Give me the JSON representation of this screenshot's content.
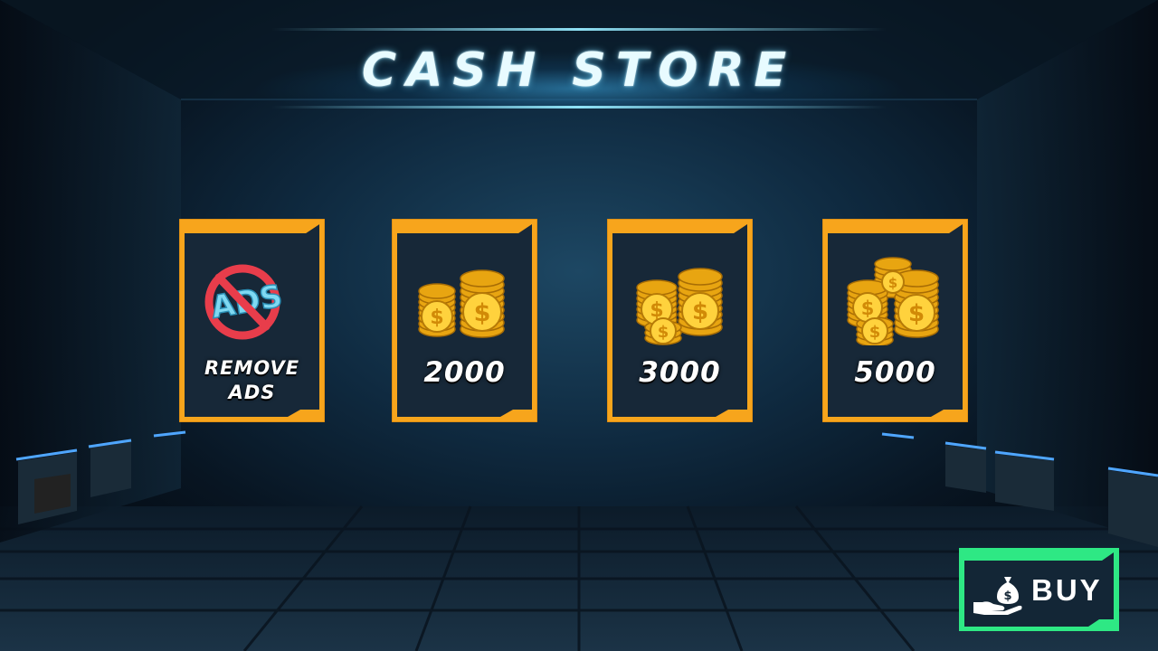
{
  "title": "CASH STORE",
  "colors": {
    "card_accent": "#f7a51c",
    "card_fill": "#172838",
    "buy_accent": "#2ee884",
    "title_glow": "#7fdcff"
  },
  "items": [
    {
      "label": "REMOVE ADS",
      "label_line1": "REMOVE",
      "label_line2": "ADS",
      "icon": "no-ads-icon",
      "ads_text": "ADS"
    },
    {
      "label": "2000",
      "icon": "coin-stack-small-icon"
    },
    {
      "label": "3000",
      "icon": "coin-stack-medium-icon"
    },
    {
      "label": "5000",
      "icon": "coin-stack-large-icon"
    }
  ],
  "buy": {
    "label": "BUY",
    "icon": "money-bag-hand-icon"
  }
}
